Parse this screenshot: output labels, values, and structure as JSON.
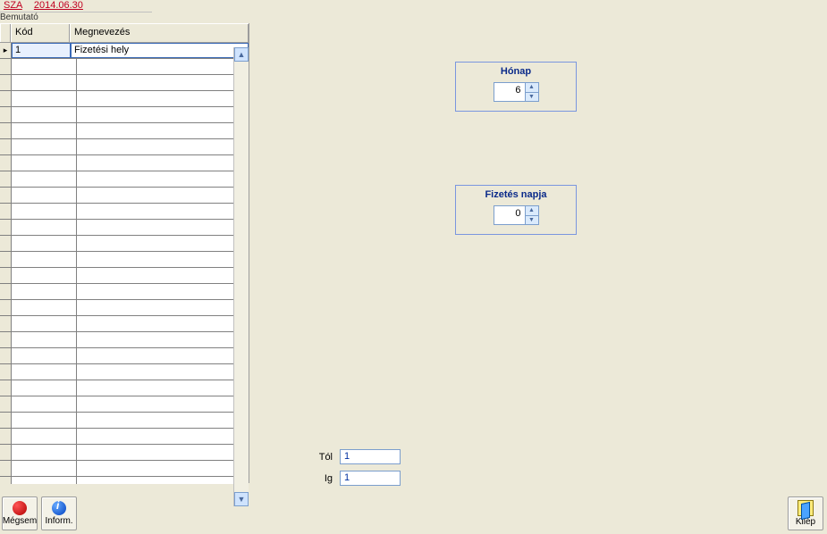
{
  "header": {
    "code": "SZA",
    "date": "2014.06.30",
    "subtitle": "Bemutató"
  },
  "grid": {
    "columns": {
      "kod": "Kód",
      "megnevezes": "Megnevezés"
    },
    "rows": [
      {
        "kod": "1",
        "megnevezes": "Fizetési hely"
      }
    ]
  },
  "panels": {
    "honap": {
      "title": "Hónap",
      "value": "6"
    },
    "fiznap": {
      "title": "Fizetés napja",
      "value": "0"
    }
  },
  "range": {
    "from_label": "Tól",
    "from_value": "1",
    "to_label": "Ig",
    "to_value": "1"
  },
  "buttons": {
    "cancel": "Mégsem",
    "inform": "Inform.",
    "exit": "Kilép"
  }
}
